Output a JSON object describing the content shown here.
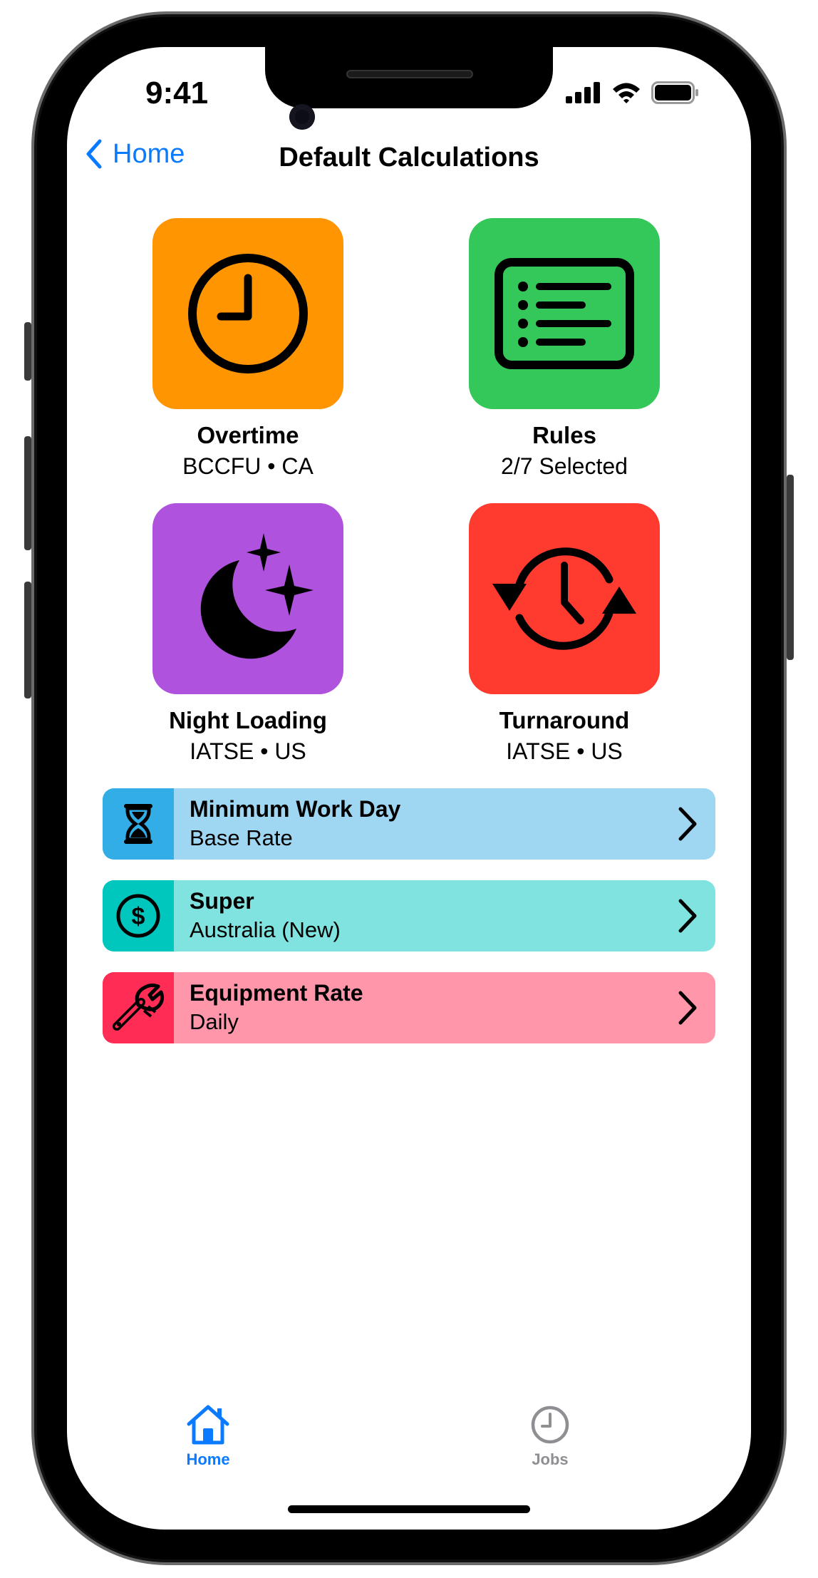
{
  "status_bar": {
    "time": "9:41"
  },
  "nav": {
    "back_label": "Home",
    "title": "Default Calculations"
  },
  "tiles": [
    {
      "title": "Overtime",
      "subtitle": "BCCFU • CA",
      "color": "#ff9500",
      "icon": "clock-icon"
    },
    {
      "title": "Rules",
      "subtitle": "2/7 Selected",
      "color": "#34c759",
      "icon": "list-icon"
    },
    {
      "title": "Night Loading",
      "subtitle": "IATSE • US",
      "color": "#af52de",
      "icon": "moon-stars-icon"
    },
    {
      "title": "Turnaround",
      "subtitle": "IATSE • US",
      "color": "#ff3b30",
      "icon": "clock-arrows-icon"
    }
  ],
  "rows": [
    {
      "title": "Minimum Work Day",
      "subtitle": "Base Rate",
      "icon_bg": "#32ade6",
      "row_bg": "#9fd6f1",
      "icon": "hourglass-icon"
    },
    {
      "title": "Super",
      "subtitle": "Australia (New)",
      "icon_bg": "#00c7be",
      "row_bg": "#80e3df",
      "icon": "dollar-circle-icon"
    },
    {
      "title": "Equipment Rate",
      "subtitle": "Daily",
      "icon_bg": "#ff2d55",
      "row_bg": "#ff96aa",
      "icon": "wrench-icon"
    }
  ],
  "tab_bar": {
    "tabs": [
      {
        "label": "Home",
        "icon": "house-icon",
        "active": true,
        "color": "#0a7aff"
      },
      {
        "label": "Jobs",
        "icon": "clock-icon",
        "active": false,
        "color": "#8e8e93"
      }
    ]
  }
}
